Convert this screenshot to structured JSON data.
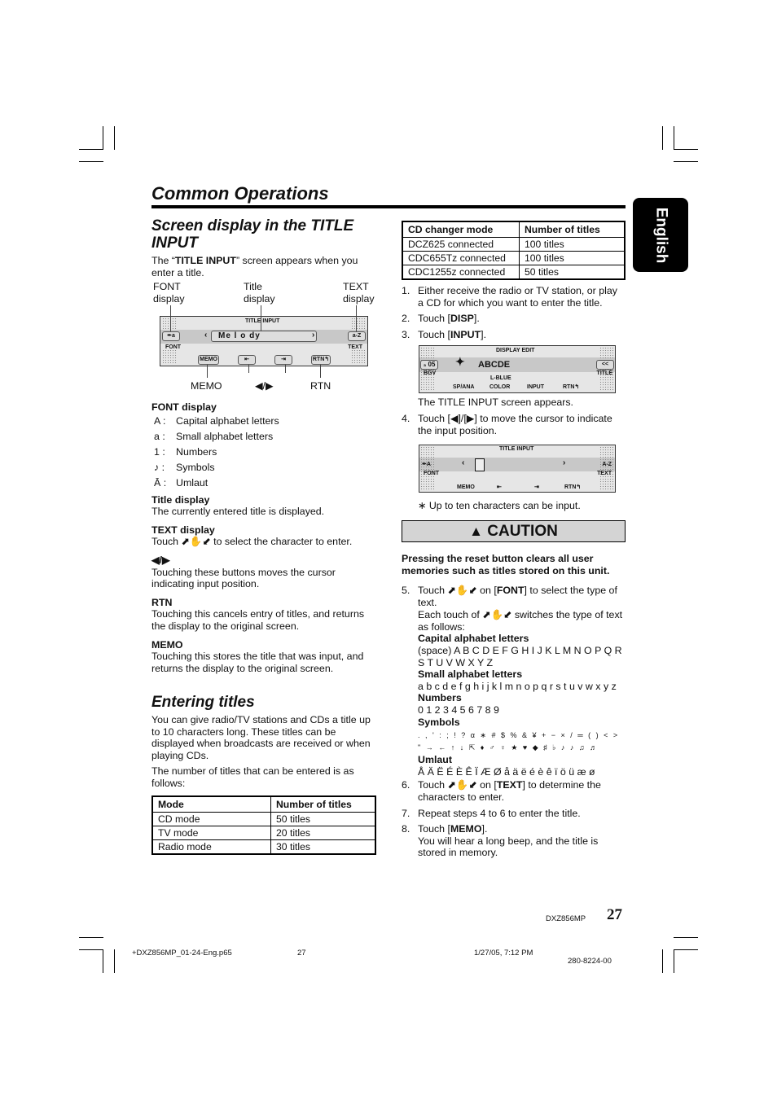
{
  "page": {
    "title": "Common Operations",
    "language_tab": "English",
    "page_number": "27",
    "model": "DXZ856MP",
    "footer_file": "+DXZ856MP_01-24-Eng.p65",
    "footer_page": "27",
    "footer_datetime": "1/27/05, 7:12 PM",
    "footer_code": "280-8224-00"
  },
  "screen_section": {
    "heading_line1": "Screen display in the TITLE",
    "heading_line2": "INPUT",
    "intro_pre": "The “",
    "intro_bold": "TITLE INPUT",
    "intro_post": "” screen appears when you enter a title.",
    "diagram": {
      "callouts": {
        "font": "FONT\ndisplay",
        "font_l1": "FONT",
        "font_l2": "display",
        "title_l1": "Title",
        "title_l2": "display",
        "text_l1": "TEXT",
        "text_l2": "display",
        "memo": "MEMO",
        "arrows": "◀/▶",
        "rtn": "RTN"
      },
      "lcd": {
        "header": "TITLE INPUT",
        "font_btn": "✒a",
        "font_label": "FONT",
        "title_value": "Me l o dy",
        "text_btn": "a-Z",
        "text_label": "TEXT",
        "memo_btn": "MEMO",
        "left_btn": "⇤",
        "right_btn": "⇥",
        "rtn_btn": "RTN↰"
      }
    },
    "font_display": {
      "heading": "FONT display",
      "items": [
        {
          "key": "A :",
          "label": "Capital alphabet letters"
        },
        {
          "key": "a :",
          "label": "Small alphabet letters"
        },
        {
          "key": "1 :",
          "label": "Numbers"
        },
        {
          "key": "♪ :",
          "label": "Symbols"
        },
        {
          "key": "Ā :",
          "label": "Umlaut"
        }
      ]
    },
    "title_display": {
      "heading": "Title display",
      "text": "The currently entered title is displayed."
    },
    "text_display": {
      "heading": "TEXT display",
      "text_pre": "Touch ",
      "icons": "⬈✋⬋",
      "text_post": " to select the character to enter."
    },
    "arrows": {
      "heading": "◀/▶",
      "text": "Touching these buttons moves the cursor indicating input position."
    },
    "rtn": {
      "heading": "RTN",
      "text": "Touching this cancels entry of titles, and returns the display to the original screen."
    },
    "memo": {
      "heading": "MEMO",
      "text": "Touching this stores the title that was input, and returns the display to the original screen."
    }
  },
  "entering_section": {
    "heading": "Entering titles",
    "para1": "You can give radio/TV stations and CDs a title up to 10 characters long. These titles can be displayed when broadcasts are received or when playing CDs.",
    "para2": "The number of titles that can be entered is as follows:",
    "table": {
      "headers": [
        "Mode",
        "Number of titles"
      ],
      "rows": [
        [
          "CD mode",
          "50 titles"
        ],
        [
          "TV mode",
          "20 titles"
        ],
        [
          "Radio mode",
          "30 titles"
        ]
      ]
    }
  },
  "right_column": {
    "cd_table": {
      "headers": [
        "CD changer mode",
        "Number of titles"
      ],
      "rows": [
        [
          "DCZ625 connected",
          "100 titles"
        ],
        [
          "CDC655Tz connected",
          "100 titles"
        ],
        [
          "CDC1255z connected",
          "50 titles"
        ]
      ]
    },
    "steps": [
      {
        "n": "1.",
        "text": "Either receive the radio or TV station, or play a CD for which you want to enter the title."
      },
      {
        "n": "2.",
        "pre": "Touch [",
        "bold": "DISP",
        "post": "]."
      },
      {
        "n": "3.",
        "pre": "Touch [",
        "bold": "INPUT",
        "post": "]."
      },
      {
        "n": "4.",
        "text": "Touch [◀]/[▶] to move the cursor to indicate the input position."
      },
      {
        "n": "5.",
        "pre": "Touch ⬈✋⬋ on [",
        "bold": "FONT",
        "post": "] to select the type of text.",
        "extra": "Each touch of ⬈✋⬋ switches the type of text as follows:"
      },
      {
        "n": "6.",
        "pre": "Touch ⬈✋⬋ on [",
        "bold": "TEXT",
        "post": "] to determine the characters to enter."
      },
      {
        "n": "7.",
        "text": "Repeat steps 4 to 6 to enter the title."
      },
      {
        "n": "8.",
        "pre": "Touch [",
        "bold": "MEMO",
        "post": "].",
        "extra": "You will hear a long beep, and the title is stored in memory."
      }
    ],
    "display_edit_lcd": {
      "header": "DISPLAY EDIT",
      "left_value": "₃ 05",
      "left_label": "BGV",
      "title": "ABCDE",
      "color_value": "L-BLUE",
      "buttons": [
        "SP/ANA",
        "COLOR",
        "INPUT",
        "RTN↰"
      ],
      "right_btn": "<<",
      "right_label": "TITLE"
    },
    "after_lcd1": "The TITLE INPUT screen appears.",
    "title_input_lcd": {
      "header": "TITLE INPUT",
      "font_btn": "✒A",
      "font_label": "FONT",
      "text_btn": "A-Z",
      "text_label": "TEXT",
      "buttons": [
        "MEMO",
        "⇤",
        "⇥",
        "RTN↰"
      ]
    },
    "note": "∗ Up to ten characters can be input.",
    "caution": {
      "label": "CAUTION",
      "icon": "warning-triangle",
      "text": "Pressing the reset button clears all user memories such as titles stored on this unit."
    },
    "charsets": [
      {
        "name": "Capital alphabet letters",
        "chars": "(space) A B C D E F G H I J K L M N O P Q R S T U V W X Y Z"
      },
      {
        "name": "Small alphabet letters",
        "chars": "a b c d e f g h i j k l m n o p q r s t u v w x y z"
      },
      {
        "name": "Numbers",
        "chars": "0 1 2 3 4 5 6 7 8 9"
      },
      {
        "name": "Symbols",
        "chars": ". , ' : ; ! ? α ∗ # $ % & ¥ + − × / ═ ( ) < >",
        "chars2": "\" → ← ↑ ↓ ⇱ ♦ ♂ ♀ ★ ♥ ◆ ♯ ♭ ♪ ♪ ♫ ♬"
      },
      {
        "name": "Umlaut",
        "chars": "Å Ä Ë É È Ê Ï Æ Ø å ä ë é è ê ï ö ü æ ø"
      }
    ]
  }
}
